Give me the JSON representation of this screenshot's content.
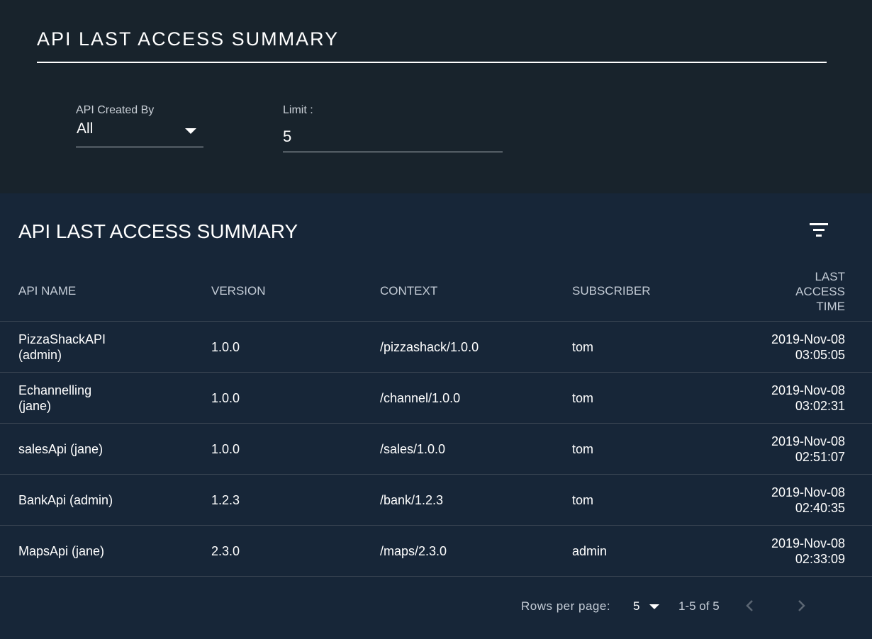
{
  "header": {
    "title": "API LAST ACCESS SUMMARY"
  },
  "filters": {
    "created_by_label": "API Created By",
    "created_by_value": "All",
    "limit_label": "Limit :",
    "limit_value": "5"
  },
  "card": {
    "title": "API LAST ACCESS SUMMARY",
    "filter_icon": "filter-list-icon"
  },
  "table": {
    "columns": {
      "api_name": "API NAME",
      "version": "VERSION",
      "context": "CONTEXT",
      "subscriber": "SUBSCRIBER",
      "last_access_time": "LAST ACCESS TIME"
    },
    "rows": [
      {
        "api_name": "PizzaShackAPI (admin)",
        "version": "1.0.0",
        "context": "/pizzashack/1.0.0",
        "subscriber": "tom",
        "last_access_time": "2019-Nov-08 03:05:05"
      },
      {
        "api_name": "Echannelling (jane)",
        "version": "1.0.0",
        "context": "/channel/1.0.0",
        "subscriber": "tom",
        "last_access_time": "2019-Nov-08 03:02:31"
      },
      {
        "api_name": "salesApi (jane)",
        "version": "1.0.0",
        "context": "/sales/1.0.0",
        "subscriber": "tom",
        "last_access_time": "2019-Nov-08 02:51:07"
      },
      {
        "api_name": "BankApi (admin)",
        "version": "1.2.3",
        "context": "/bank/1.2.3",
        "subscriber": "tom",
        "last_access_time": "2019-Nov-08 02:40:35"
      },
      {
        "api_name": "MapsApi (jane)",
        "version": "2.3.0",
        "context": "/maps/2.3.0",
        "subscriber": "admin",
        "last_access_time": "2019-Nov-08 02:33:09"
      }
    ]
  },
  "pagination": {
    "rows_per_page_label": "Rows per page:",
    "rows_per_page_value": "5",
    "range_text": "1-5 of 5",
    "prev_icon": "chevron-left-icon",
    "next_icon": "chevron-right-icon"
  }
}
